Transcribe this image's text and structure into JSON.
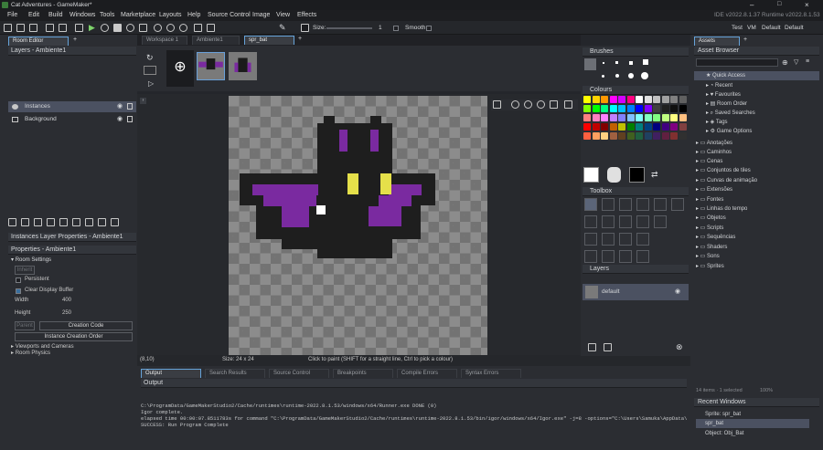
{
  "window": {
    "title": "Cat Adventures - GameMaker*",
    "ide_version": "IDE v2022.8.1.37  Runtime v2022.8.1.53",
    "targets": [
      "Test",
      "VM",
      "Default",
      "Default"
    ]
  },
  "menu": [
    "File",
    "Edit",
    "Build",
    "Windows",
    "Tools",
    "Marketplace",
    "Layouts",
    "Help",
    "Source Control",
    "Image",
    "View",
    "Effects"
  ],
  "editor_tabs": [
    {
      "label": "Workspace 1"
    },
    {
      "label": "Ambiente1"
    },
    {
      "label": "spr_bat"
    }
  ],
  "room_editor": {
    "tab": "Room Editor",
    "layers_title": "Layers - Ambiente1",
    "layers": [
      {
        "name": "Instances"
      },
      {
        "name": "Background"
      }
    ]
  },
  "instances_props": {
    "title": "Instances Layer Properties - Ambiente1"
  },
  "properties": {
    "title": "Properties - Ambiente1",
    "room_settings": "Room Settings",
    "inherit": "Inherit",
    "persistent": "Persistent",
    "clear_display": "Clear Display Buffer",
    "width_label": "Width",
    "width": "400",
    "height_label": "Height",
    "height": "250",
    "parent": "Parent",
    "creation_code": "Creation Code",
    "instance_order": "Instance Creation Order",
    "viewports": "Viewports and Cameras",
    "physics": "Room Physics"
  },
  "sprite_editor": {
    "size_label": "Size:",
    "size_value": "1",
    "smooth": "Smooth",
    "cursor": "(8,10)",
    "size_info": "Size: 24 x 24",
    "hint": "Click to paint (SHIFT for a straight line, Ctrl to pick a colour)"
  },
  "brushes": {
    "title": "Brushes"
  },
  "colours": {
    "title": "Colours",
    "swatches": [
      "#ffff00",
      "#ffd400",
      "#ff9900",
      "#ff00ff",
      "#d400ff",
      "#ff0080",
      "#ffffff",
      "#e0e0e0",
      "#c0c0c0",
      "#a0a0a0",
      "#808080",
      "#606060",
      "#80ff00",
      "#00ff00",
      "#00ff80",
      "#00ffff",
      "#00c0ff",
      "#0080ff",
      "#0000ff",
      "#8000ff",
      "#404040",
      "#202020",
      "#101010",
      "#000000",
      "#ff8080",
      "#ff80c0",
      "#ff80ff",
      "#c080ff",
      "#8080ff",
      "#80c0ff",
      "#80ffff",
      "#80ffc0",
      "#80ff80",
      "#c0ff80",
      "#ffff80",
      "#ffc080",
      "#ff0000",
      "#c00000",
      "#800000",
      "#c06000",
      "#c0c000",
      "#008000",
      "#008080",
      "#004080",
      "#000080",
      "#400080",
      "#800080",
      "#804040",
      "#ff6040",
      "#ffa060",
      "#ffd080",
      "#a06040",
      "#604020",
      "#406020",
      "#206040",
      "#204060",
      "#402060",
      "#602040",
      "#803030",
      "#303030"
    ],
    "primary": "#ffffff",
    "secondary": "#000000"
  },
  "toolbox": {
    "title": "Toolbox"
  },
  "sprite_layers": {
    "title": "Layers",
    "items": [
      {
        "name": "default"
      }
    ]
  },
  "output": {
    "tabs": [
      "Output",
      "Search Results",
      "Source Control",
      "Breakpoints",
      "Compile Errors",
      "Syntax Errors"
    ],
    "header": "Output",
    "lines": [
      "C:\\ProgramData/GameMakerStudio2/Cache/runtimes\\runtime-2022.8.1.53/windows/x64/Runner.exe DONE (0)",
      "Igor complete.",
      "elapsed time 00:00:07.8511783s for command \"C:\\ProgramData/GameMakerStudio2/Cache/runtimes\\runtime-2022.8.1.53/bin/igor/windows/x64/Igor.exe\" -j=8 -options=\"C:\\Users\\Samuka\\AppData\\Local\\GameMakerStudio2\\GA",
      "SUCCESS: Run Program Complete"
    ]
  },
  "assets": {
    "tab": "Assets",
    "browser": "Asset Browser",
    "quick_access": "Quick Access",
    "quick_items": [
      "Recent",
      "Favourites",
      "Room Order",
      "Saved Searches",
      "Tags",
      "Game Options"
    ],
    "folders": [
      "Anotações",
      "Caminhos",
      "Cenas",
      "Conjuntos de tiles",
      "Curvas de animação",
      "Extensões",
      "Fontes",
      "Linhas do tempo",
      "Objetos",
      "Scripts",
      "Sequências",
      "Shaders",
      "Sons",
      "Sprites"
    ],
    "status": "14 items · 1 selected",
    "zoom": "100%"
  },
  "recent_windows": {
    "title": "Recent Windows",
    "items": [
      "Sprite: spr_bat",
      "spr_bat",
      "Object: Obj_Bat"
    ]
  }
}
